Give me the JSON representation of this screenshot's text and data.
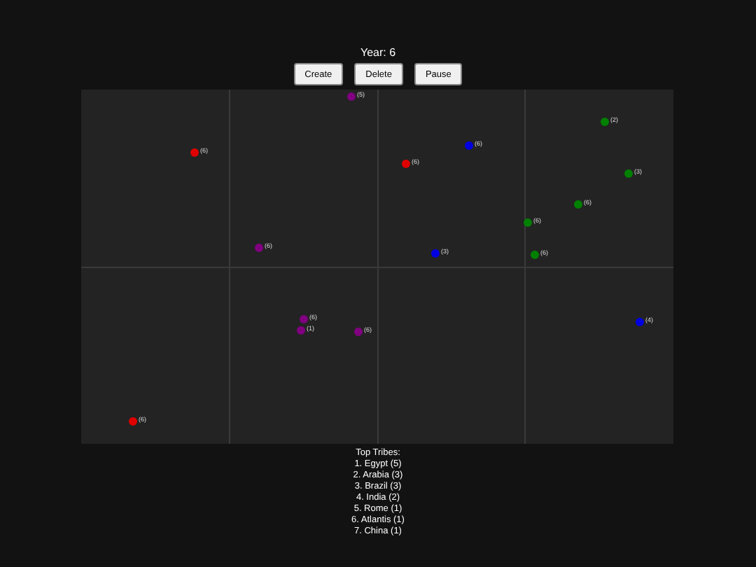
{
  "year_label": "Year: 6",
  "buttons": [
    "Create",
    "Delete",
    "Pause"
  ],
  "points": [
    {
      "label": "(5)",
      "color": "#800080"
    },
    {
      "label": "(6)",
      "color": "#e00000"
    },
    {
      "label": "(6)",
      "color": "#800080"
    },
    {
      "label": "(6)",
      "color": "#0000e0"
    },
    {
      "label": "(6)",
      "color": "#e00000"
    },
    {
      "label": "(2)",
      "color": "#008000"
    },
    {
      "label": "(3)",
      "color": "#008000"
    },
    {
      "label": "(6)",
      "color": "#008000"
    },
    {
      "label": "(6)",
      "color": "#008000"
    },
    {
      "label": "(3)",
      "color": "#0000e0"
    },
    {
      "label": "(6)",
      "color": "#008000"
    },
    {
      "label": "(6)",
      "color": "#800080"
    },
    {
      "label": "(1)",
      "color": "#800080"
    },
    {
      "label": "(6)",
      "color": "#800080"
    },
    {
      "label": "(6)",
      "color": "#e00000"
    },
    {
      "label": "(4)",
      "color": "#0000e0"
    }
  ],
  "top_tribes": {
    "title": "Top Tribes:",
    "items": [
      "1. Egypt (5)",
      "2. Arabia (3)",
      "3. Brazil (3)",
      "4. India (2)",
      "5. Rome (1)",
      "6. Atlantis (1)",
      "7. China (1)"
    ]
  }
}
